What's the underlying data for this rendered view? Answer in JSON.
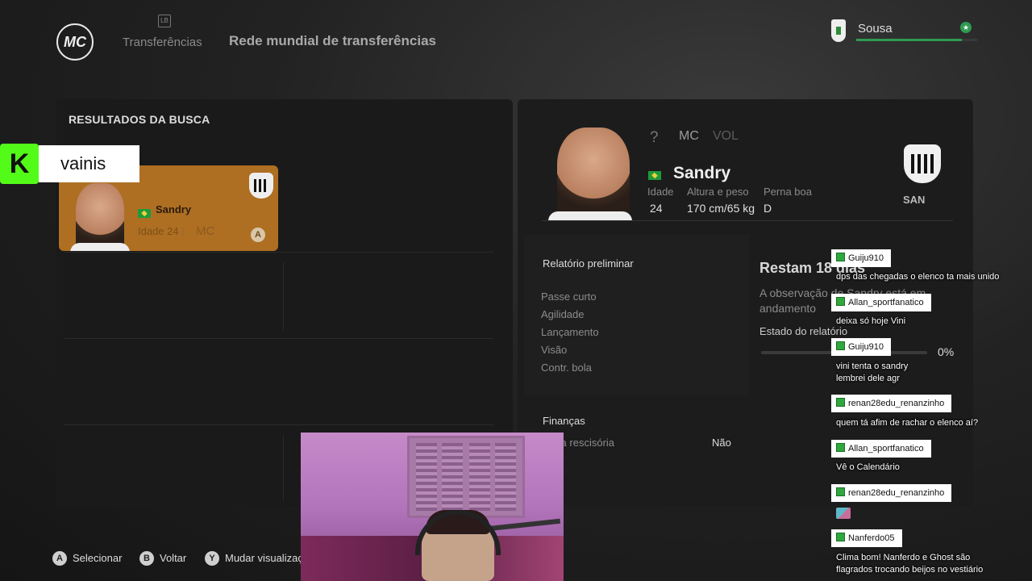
{
  "header": {
    "logo": "MC",
    "lb_hint": "LB",
    "tab_transfers": "Transferências",
    "page_title": "Rede mundial de transferências",
    "manager_name": "Sousa",
    "progress": 0.87,
    "accent_color": "#2e9b52"
  },
  "search": {
    "title": "RESULTADOS DA BUSCA",
    "card": {
      "name": "Sandry",
      "age_text": "Idade 24",
      "sep": "|",
      "position": "MC",
      "badge": "A",
      "card_color": "#ae6f23"
    }
  },
  "streamer": {
    "platform_icon": "K",
    "name": "vainis"
  },
  "player": {
    "unknown": "?",
    "pos_main": "MC",
    "pos_alt": "VOL",
    "name": "Sandry",
    "age_label": "Idade",
    "age": "24",
    "hw_label": "Altura e peso",
    "hw": "170 cm/65 kg",
    "foot_label": "Perna boa",
    "foot": "D",
    "club": "SAN"
  },
  "report": {
    "title": "Relatório preliminar",
    "attributes": [
      "Passe curto",
      "Agilidade",
      "Lançamento",
      "Visão",
      "Contr. bola"
    ],
    "remaining": "Restam 18 dias",
    "observation": "A observação de Sandry está em andamento",
    "status_label": "Estado do relatório",
    "status_pct": "0%",
    "finance_title": "Finanças",
    "finance_label": "Multa rescisória",
    "finance_value": "Não"
  },
  "hints": [
    {
      "btn": "A",
      "label": "Selecionar"
    },
    {
      "btn": "B",
      "label": "Voltar"
    },
    {
      "btn": "Y",
      "label": "Mudar visualização"
    }
  ],
  "chat": [
    {
      "user": "Guiju910",
      "msg": [
        "dps das chegadas o elenco ta mais unido"
      ]
    },
    {
      "user": "Allan_sportfanatico",
      "msg": [
        "deixa só hoje Vini"
      ]
    },
    {
      "user": "Guiju910",
      "msg": [
        "vini tenta o sandry",
        "lembrei dele agr"
      ]
    },
    {
      "user": "renan28edu_renanzinho",
      "msg": [
        "quem tá afim de rachar o elenco aí?"
      ]
    },
    {
      "user": "Allan_sportfanatico",
      "msg": [
        "Vê o Calendário"
      ]
    },
    {
      "user": "renan28edu_renanzinho",
      "msg": [],
      "emote": "emote-icon"
    },
    {
      "user": "Nanferdo05",
      "msg": [
        "Clima bom! Nanferdo e Ghost são",
        "flagrados trocando beijos no vestiário"
      ]
    }
  ]
}
